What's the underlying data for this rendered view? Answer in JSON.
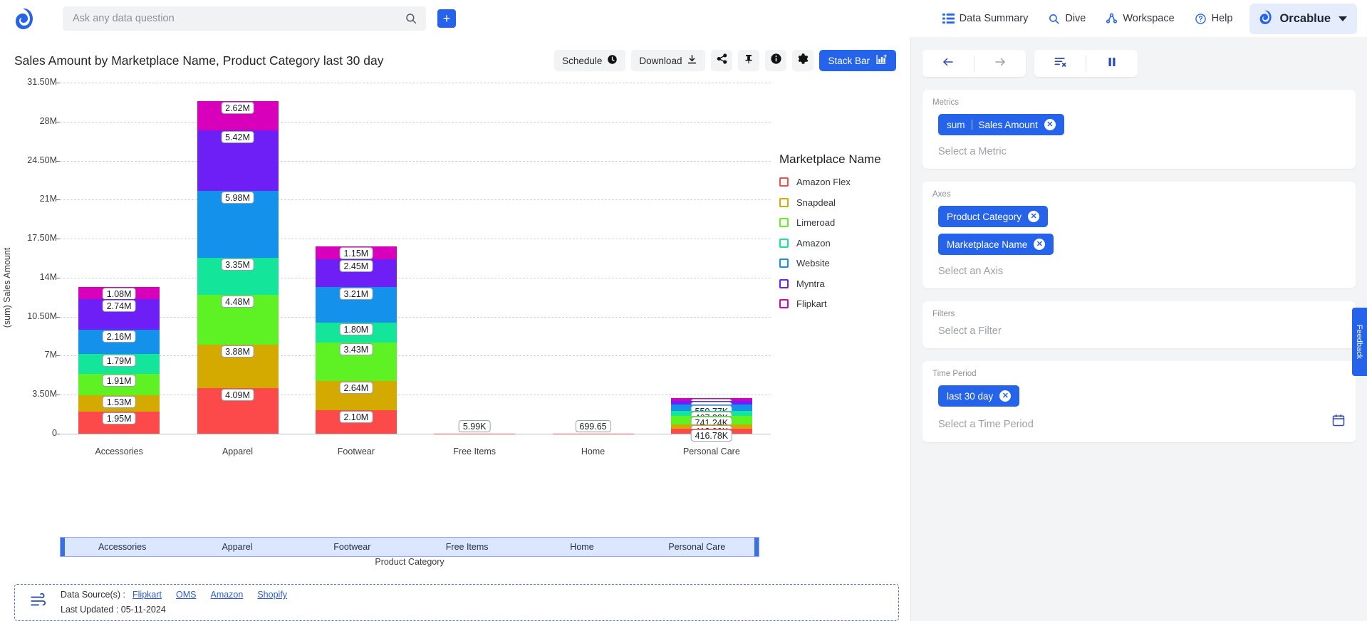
{
  "topnav": {
    "logo": "orcablue-logo",
    "search": {
      "placeholder": "Ask any data question",
      "value": ""
    },
    "add_button": "+",
    "items": [
      {
        "label": "Data Summary",
        "icon": "list-icon"
      },
      {
        "label": "Dive",
        "icon": "search-icon"
      },
      {
        "label": "Workspace",
        "icon": "share-nodes-icon"
      },
      {
        "label": "Help",
        "icon": "question-circle-icon"
      }
    ],
    "user": {
      "name": "Orcablue"
    }
  },
  "chart_header": {
    "title": "Sales Amount by Marketplace Name, Product Category last 30 day",
    "schedule_label": "Schedule",
    "download_label": "Download",
    "share_label": "share-icon",
    "pin_label": "pin-icon",
    "info_label": "info-icon",
    "settings_label": "settings-icon",
    "stack_bar_label": "Stack Bar"
  },
  "chart_data": {
    "type": "bar",
    "stacked": true,
    "title": "Sales Amount by Marketplace Name, Product Category last 30 day",
    "xlabel": "Product Category",
    "ylabel": "(sum) Sales Amount",
    "legend_title": "Marketplace Name",
    "legend_position": "right",
    "grid": true,
    "ylim": [
      0,
      31500000
    ],
    "yticks": [
      0,
      3500000,
      7000000,
      10500000,
      14000000,
      17500000,
      21000000,
      24500000,
      28000000,
      31500000
    ],
    "ytick_labels": [
      "0",
      "3.50M",
      "7M",
      "10.50M",
      "14M",
      "17.50M",
      "21M",
      "24.50M",
      "28M",
      "31.50M"
    ],
    "categories": [
      "Accessories",
      "Apparel",
      "Footwear",
      "Free Items",
      "Home",
      "Personal Care"
    ],
    "series": [
      {
        "name": "Amazon Flex",
        "color": "#fc4a4a",
        "values": [
          1950000,
          4090000,
          2100000,
          1000,
          120,
          416780
        ],
        "labels": [
          "1.95M",
          "4.09M",
          "2.10M",
          "",
          "",
          "416.78K"
        ]
      },
      {
        "name": "Snapdeal",
        "color": "#d4aa00",
        "values": [
          1530000,
          3880000,
          2640000,
          1000,
          120,
          413900
        ],
        "labels": [
          "1.53M",
          "3.88M",
          "2.64M",
          "",
          "",
          "413.90K"
        ]
      },
      {
        "name": "Limeroad",
        "color": "#5ef123",
        "values": [
          1910000,
          4480000,
          3430000,
          1000,
          120,
          741240
        ],
        "labels": [
          "1.91M",
          "4.48M",
          "3.43M",
          "",
          "",
          "741.24K"
        ]
      },
      {
        "name": "Amazon",
        "color": "#13e59a",
        "values": [
          1790000,
          3350000,
          1800000,
          1000,
          120,
          467320
        ],
        "labels": [
          "1.79M",
          "3.35M",
          "1.80M",
          "",
          "",
          "467.32K"
        ]
      },
      {
        "name": "Website",
        "color": "#1391eb",
        "values": [
          2160000,
          5980000,
          3210000,
          1000,
          120,
          559770
        ],
        "labels": [
          "2.16M",
          "5.98M",
          "3.21M",
          "",
          "",
          "559.77K"
        ]
      },
      {
        "name": "Myntra",
        "color": "#6d1ff5",
        "values": [
          2740000,
          5420000,
          2450000,
          1000,
          120,
          308520
        ],
        "labels": [
          "2.74M",
          "5.42M",
          "2.45M",
          "",
          "",
          "308.52K"
        ]
      },
      {
        "name": "Flipkart",
        "color": "#d900bb",
        "values": [
          1080000,
          2620000,
          1150000,
          990,
          119,
          302190
        ],
        "labels": [
          "1.08M",
          "2.62M",
          "1.15M",
          "",
          "",
          "302.19K"
        ]
      }
    ],
    "small_bar_labels": {
      "Free Items": "5.99K",
      "Home": "699.65"
    },
    "totals": [
      "13.16M",
      "29.82M",
      "16.78M",
      "5.99K",
      "699.65",
      "3.21M"
    ]
  },
  "xband": {
    "cells": [
      "Accessories",
      "Apparel",
      "Footwear",
      "Free Items",
      "Home",
      "Personal Care"
    ],
    "title": "Product Category"
  },
  "footer": {
    "icon": "data-source-icon",
    "sources_label": "Data Source(s) :",
    "sources": [
      "Flipkart",
      "OMS",
      "Amazon",
      "Shopify"
    ],
    "last_updated": "Last Updated : 05-11-2024"
  },
  "right_panel": {
    "toolbar": {
      "back": "back-arrow-icon",
      "forward": "forward-arrow-icon",
      "clear": "clear-filter-icon",
      "pause": "pause-icon"
    },
    "metrics": {
      "label": "Metrics",
      "chips": [
        {
          "agg": "sum",
          "field": "Sales Amount"
        }
      ],
      "placeholder": "Select a Metric"
    },
    "axes": {
      "label": "Axes",
      "chips": [
        {
          "field": "Product Category"
        },
        {
          "field": "Marketplace Name"
        }
      ],
      "placeholder": "Select an Axis"
    },
    "filters": {
      "label": "Filters",
      "placeholder": "Select a Filter"
    },
    "time_period": {
      "label": "Time Period",
      "chips": [
        {
          "field": "last 30 day"
        }
      ],
      "placeholder": "Select a Time Period",
      "calendar_icon": "calendar-icon"
    }
  },
  "feedback": {
    "label": "Feedback"
  },
  "colors": {
    "accent": "#2563eb",
    "chip": "#2563eb",
    "panel_bg": "#f3f4f6"
  }
}
